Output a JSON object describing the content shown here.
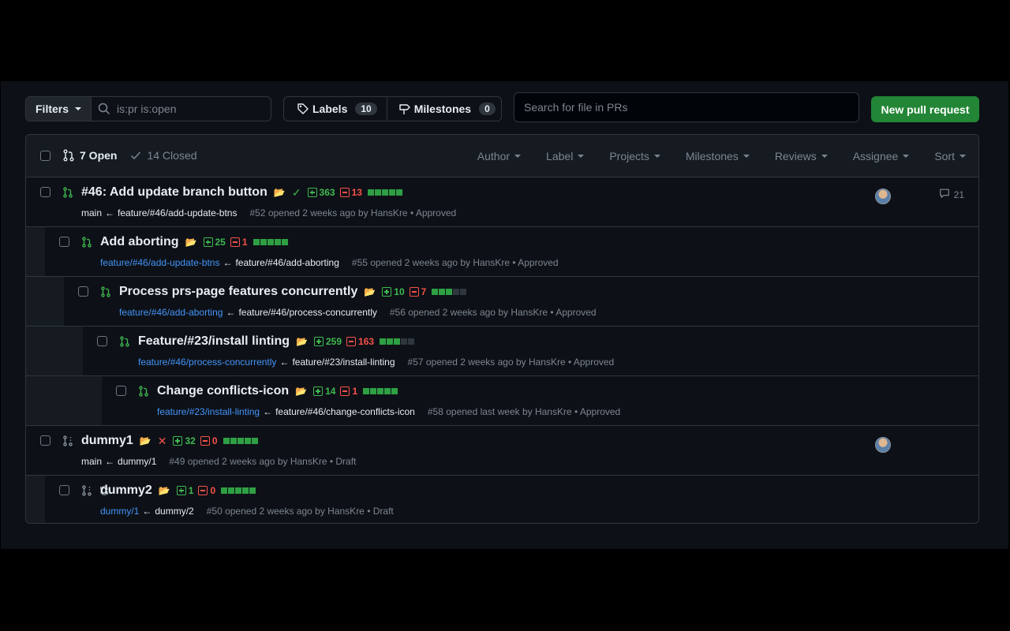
{
  "toolbar": {
    "filters_label": "Filters",
    "filter_query": "is:pr is:open",
    "labels_label": "Labels",
    "labels_count": "10",
    "milestones_label": "Milestones",
    "milestones_count": "0",
    "search_placeholder": "Search for file in PRs",
    "new_pr_label": "New pull request"
  },
  "list_header": {
    "open_label": "7 Open",
    "closed_label": "14 Closed",
    "filters": [
      "Author",
      "Label",
      "Projects",
      "Milestones",
      "Reviews",
      "Assignee",
      "Sort"
    ]
  },
  "pull_requests": [
    {
      "title": "#46: Add update branch button",
      "status_mark": "✓",
      "additions": "363",
      "deletions": "13",
      "base": "main",
      "head": "feature/#46/add-update-btns",
      "meta": "#52 opened 2 weeks ago by HansKre • Approved",
      "comments": "21",
      "bar": "ggggg"
    },
    {
      "title": "Add aborting",
      "status_mark": "",
      "additions": "25",
      "deletions": "1",
      "base": "feature/#46/add-update-btns",
      "head": "feature/#46/add-aborting",
      "meta": "#55 opened 2 weeks ago by HansKre • Approved",
      "bar": "ggggg"
    },
    {
      "title": "Process prs-page features concurrently",
      "status_mark": "",
      "additions": "10",
      "deletions": "7",
      "base": "feature/#46/add-aborting",
      "head": "feature/#46/process-concurrently",
      "meta": "#56 opened 2 weeks ago by HansKre • Approved",
      "bar": "gggnn"
    },
    {
      "title": "Feature/#23/install linting",
      "status_mark": "",
      "additions": "259",
      "deletions": "163",
      "base": "feature/#46/process-concurrently",
      "head": "feature/#23/install-linting",
      "meta": "#57 opened 2 weeks ago by HansKre • Approved",
      "bar": "gggnn"
    },
    {
      "title": "Change conflicts-icon",
      "status_mark": "",
      "additions": "14",
      "deletions": "1",
      "base": "feature/#23/install-linting",
      "head": "feature/#46/change-conflicts-icon",
      "meta": "#58 opened last week by HansKre • Approved",
      "bar": "ggggg"
    },
    {
      "title": "dummy1",
      "status_mark": "✕",
      "additions": "32",
      "deletions": "0",
      "base": "main",
      "head": "dummy/1",
      "meta": "#49 opened 2 weeks ago by HansKre • Draft",
      "bar": "ggggg"
    },
    {
      "title": "dummy2",
      "status_mark": "",
      "additions": "1",
      "deletions": "0",
      "base": "dummy/1",
      "head": "dummy/2",
      "meta": "#50 opened 2 weeks ago by HansKre • Draft",
      "bar": "ggggg"
    }
  ],
  "colors": {
    "accent_green": "#238636",
    "open_green": "#3fb950",
    "deletion_red": "#f85149",
    "link_blue": "#4493f8"
  },
  "icons": [
    "search-icon",
    "tag-icon",
    "milestone-icon",
    "pull-request-icon",
    "draft-pr-icon",
    "sync-icon",
    "check-icon",
    "folder-icon",
    "comment-icon",
    "avatar"
  ]
}
